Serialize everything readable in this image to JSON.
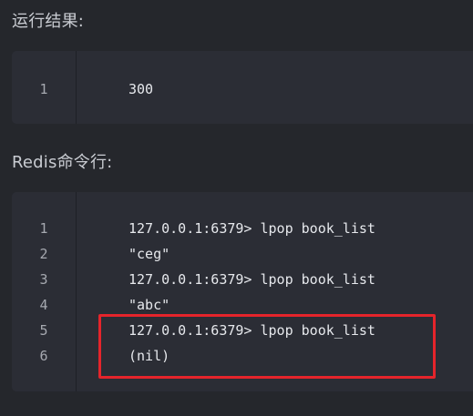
{
  "sections": {
    "result_heading": "运行结果:",
    "redis_heading": "Redis命令行:"
  },
  "result_block": {
    "lines": [
      {
        "number": "1",
        "code": "300"
      }
    ]
  },
  "redis_block": {
    "lines": [
      {
        "number": "1",
        "code": "127.0.0.1:6379> lpop book_list"
      },
      {
        "number": "2",
        "code": "\"ceg\""
      },
      {
        "number": "3",
        "code": "127.0.0.1:6379> lpop book_list"
      },
      {
        "number": "4",
        "code": "\"abc\""
      },
      {
        "number": "5",
        "code": "127.0.0.1:6379> lpop book_list"
      },
      {
        "number": "6",
        "code": "(nil)"
      }
    ]
  },
  "colors": {
    "page_background": "#25272c",
    "code_background": "#2b2d35",
    "highlight_border": "#e5242b"
  }
}
